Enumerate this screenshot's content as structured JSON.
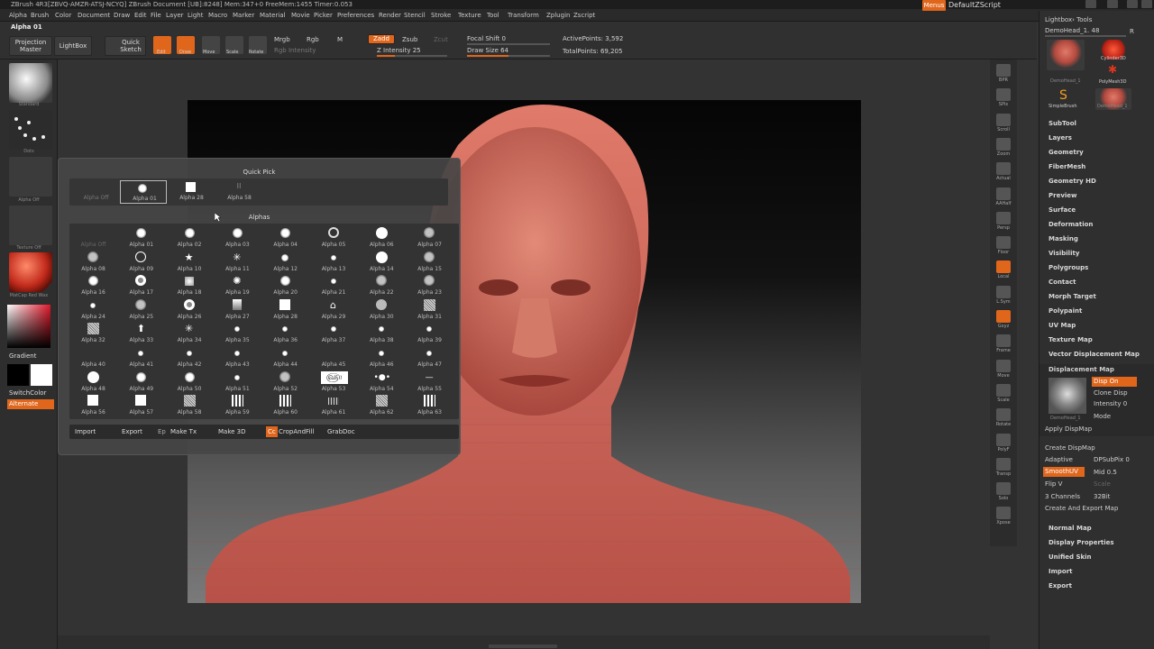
{
  "window": {
    "title": "ZBrush 4R3[ZBVQ-AMZR-ATSJ-NCYQ]   ZBrush Document   [UB]:8248]   Mem:347+0   FreeMem:1455   Timer:0.053",
    "menus_button": "Menus",
    "script": "DefaultZScript"
  },
  "menubar": [
    "Alpha",
    "Brush",
    "Color",
    "Document",
    "Draw",
    "Edit",
    "File",
    "Layer",
    "Light",
    "Macro",
    "Marker",
    "Material",
    "Movie",
    "Picker",
    "Preferences",
    "Render",
    "Stencil",
    "Stroke",
    "Texture",
    "Tool",
    "Transform",
    "Zplugin",
    "Zscript"
  ],
  "toolbar": {
    "palette_label": "Alpha 01",
    "projection_master": "Projection Master",
    "lightbox": "LightBox",
    "quick_sketch": "Quick Sketch",
    "edit": "Edit",
    "draw": "Draw",
    "move": "Move",
    "scale": "Scale",
    "rotate": "Rotate",
    "mrgb": "Mrgb",
    "rgb": "Rgb",
    "m": "M",
    "rgb_intensity": "Rgb Intensity",
    "zadd": "Zadd",
    "zsub": "Zsub",
    "zcut": "Zcut",
    "z_intensity": "Z Intensity 25",
    "focal_shift": "Focal Shift 0",
    "draw_size": "Draw Size 64",
    "active_points": "ActivePoints: 3,592",
    "total_points": "TotalPoints: 69,205",
    "draw_size_level": 0.5,
    "z_intensity_level": 0.25
  },
  "leftshelf": {
    "brush": "Standard",
    "stroke": "Dots",
    "alpha": "Alpha Off",
    "texture": "Texture Off",
    "material": "MatCap Red Wax",
    "gradient": "Gradient",
    "switch_color": "SwitchColor",
    "alternate": "Alternate"
  },
  "popup": {
    "quick_pick_title": "Quick Pick",
    "quick_pick": [
      "Alpha Off",
      "Alpha 01",
      "Alpha 28",
      "Alpha 58"
    ],
    "alphas_title": "Alphas",
    "alphas": [
      "Alpha Off",
      "Alpha 01",
      "Alpha 02",
      "Alpha 03",
      "Alpha 04",
      "Alpha 05",
      "Alpha 06",
      "Alpha 07",
      "Alpha 08",
      "Alpha 09",
      "Alpha 10",
      "Alpha 11",
      "Alpha 12",
      "Alpha 13",
      "Alpha 14",
      "Alpha 15",
      "Alpha 16",
      "Alpha 17",
      "Alpha 18",
      "Alpha 19",
      "Alpha 20",
      "Alpha 21",
      "Alpha 22",
      "Alpha 23",
      "Alpha 24",
      "Alpha 25",
      "Alpha 26",
      "Alpha 27",
      "Alpha 28",
      "Alpha 29",
      "Alpha 30",
      "Alpha 31",
      "Alpha 32",
      "Alpha 33",
      "Alpha 34",
      "Alpha 35",
      "Alpha 36",
      "Alpha 37",
      "Alpha 38",
      "Alpha 39",
      "Alpha 40",
      "Alpha 41",
      "Alpha 42",
      "Alpha 43",
      "Alpha 44",
      "Alpha 45",
      "Alpha 46",
      "Alpha 47",
      "Alpha 48",
      "Alpha 49",
      "Alpha 50",
      "Alpha 51",
      "Alpha 52",
      "Alpha 53",
      "Alpha 54",
      "Alpha 55",
      "Alpha 56",
      "Alpha 57",
      "Alpha 58",
      "Alpha 59",
      "Alpha 60",
      "Alpha 61",
      "Alpha 62",
      "Alpha 63"
    ],
    "footer": {
      "import": "Import",
      "export": "Export",
      "ep": "Ep",
      "make_tx": "Make Tx",
      "make_3d": "Make 3D",
      "cc": "Cc",
      "crop_and_fill": "CropAndFill",
      "grab_doc": "GrabDoc"
    }
  },
  "right_buttons": [
    "BPR",
    "SPix",
    "Scroll",
    "Zoom",
    "Actual",
    "AAHalf",
    "Persp",
    "Floor",
    "Local",
    "L.Sym",
    "Gxyz",
    "Frame",
    "Move",
    "Scale",
    "Rotate",
    "PolyF",
    "Transp",
    "Solo",
    "Xpose"
  ],
  "rightpanel": {
    "header": "Lightbox› Tools",
    "current_tool": "DemoHead_1. 48",
    "r": "R",
    "tools": [
      "DemoHead_1",
      "Cylinder3D",
      "PolyMesh3D",
      "SimpleBrush",
      "DemoHead_1"
    ],
    "sections": [
      "SubTool",
      "Layers",
      "Geometry",
      "FiberMesh",
      "Geometry HD",
      "Preview",
      "Surface",
      "Deformation",
      "Masking",
      "Visibility",
      "Polygroups",
      "Contact",
      "Morph Target",
      "Polypaint",
      "UV Map",
      "Texture Map",
      "Vector Displacement Map"
    ],
    "displacement": {
      "title": "Displacement Map",
      "disp_on": "Disp On",
      "clone_disp": "Clone Disp",
      "intensity": "Intensity 0",
      "mode": "Mode",
      "thumb_label": "DemoHead_1",
      "apply": "Apply DispMap",
      "create": "Create DispMap",
      "adaptive": "Adaptive",
      "dpsubpix": "DPSubPix 0",
      "smooth_uv": "SmoothUV",
      "mid": "Mid 0.5",
      "flip_v": "Flip V",
      "scale": "Scale",
      "channels": "3 Channels",
      "bit": "32Bit",
      "create_export": "Create And Export Map"
    },
    "sections2": [
      "Normal Map",
      "Display Properties",
      "Unified Skin",
      "Import",
      "Export"
    ]
  },
  "colors": {
    "accent": "#e0661c",
    "skin": "#c9665a"
  }
}
